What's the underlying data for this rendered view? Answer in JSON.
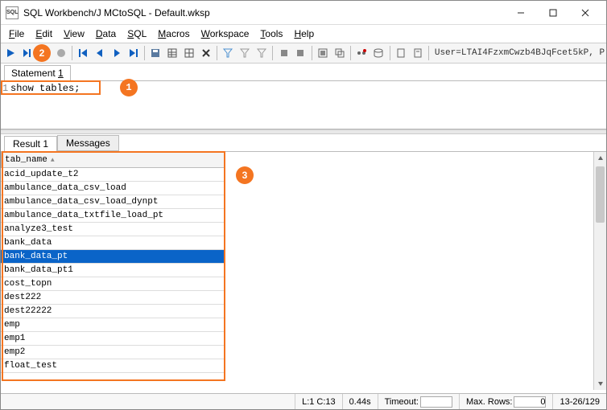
{
  "window": {
    "title": "SQL Workbench/J MCtoSQL - Default.wksp",
    "app_icon_text": "SQL"
  },
  "menu": {
    "file": "File",
    "edit": "Edit",
    "view": "View",
    "data": "Data",
    "sql": "SQL",
    "macros": "Macros",
    "workspace": "Workspace",
    "tools": "Tools",
    "help": "Help"
  },
  "toolbar": {
    "connection_string": "User=LTAI4FzxmCwzb4BJqFcet5kP, P"
  },
  "statement_tab": {
    "label": "Statement 1"
  },
  "editor": {
    "line_number": "1",
    "code": "show tables;"
  },
  "result_tabs": {
    "result1": "Result 1",
    "messages": "Messages"
  },
  "table": {
    "column_header": "tab_name",
    "rows": [
      "acid_update_t2",
      "ambulance_data_csv_load",
      "ambulance_data_csv_load_dynpt",
      "ambulance_data_txtfile_load_pt",
      "analyze3_test",
      "bank_data",
      "bank_data_pt",
      "bank_data_pt1",
      "cost_topn",
      "dest222",
      "dest22222",
      "emp",
      "emp1",
      "emp2",
      "float_test"
    ],
    "selected_index": 6
  },
  "status": {
    "cursor": "L:1 C:13",
    "time": "0.44s",
    "timeout_label": "Timeout:",
    "timeout_value": "",
    "maxrows_label": "Max. Rows:",
    "maxrows_value": "0",
    "range": "13-26/129"
  },
  "callouts": {
    "c1": "1",
    "c2": "2",
    "c3": "3"
  }
}
